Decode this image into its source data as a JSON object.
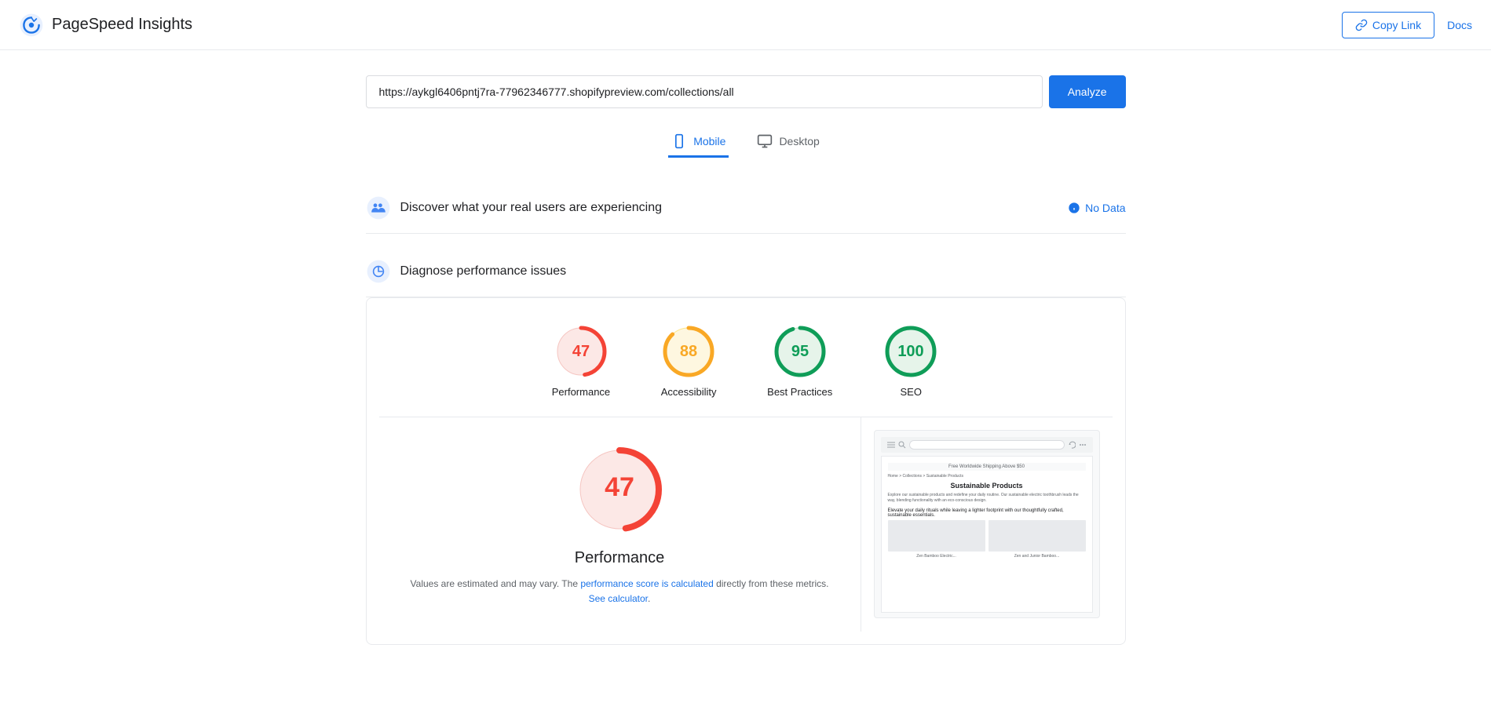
{
  "header": {
    "app_name": "PageSpeed Insights",
    "copy_link_label": "Copy Link",
    "docs_label": "Docs"
  },
  "url_bar": {
    "url_value": "https://aykgl6406pntj7ra-77962346777.shopifypreview.com/collections/all",
    "analyze_label": "Analyze"
  },
  "device_tabs": [
    {
      "id": "mobile",
      "label": "Mobile",
      "active": true
    },
    {
      "id": "desktop",
      "label": "Desktop",
      "active": false
    }
  ],
  "real_users_section": {
    "title": "Discover what your real users are experiencing",
    "no_data_label": "No Data"
  },
  "diagnose_section": {
    "title": "Diagnose performance issues"
  },
  "scores": [
    {
      "id": "performance",
      "value": 47,
      "label": "Performance",
      "color": "#f44336",
      "bg_color": "#fce8e6",
      "stroke_color": "#f44336",
      "percent": 47
    },
    {
      "id": "accessibility",
      "value": 88,
      "label": "Accessibility",
      "color": "#f9a825",
      "bg_color": "#fef7e0",
      "stroke_color": "#f9a825",
      "percent": 88
    },
    {
      "id": "best-practices",
      "value": 95,
      "label": "Best Practices",
      "color": "#0f9d58",
      "bg_color": "#e6f4ea",
      "stroke_color": "#0f9d58",
      "percent": 95
    },
    {
      "id": "seo",
      "value": 100,
      "label": "SEO",
      "color": "#0f9d58",
      "bg_color": "#e6f4ea",
      "stroke_color": "#0f9d58",
      "percent": 100
    }
  ],
  "detail": {
    "score": 47,
    "title": "Performance",
    "note_part1": "Values are estimated and may vary. The ",
    "note_link1": "performance score is calculated",
    "note_part2": " directly from these metrics. ",
    "note_link2": "See calculator",
    "note_end": "."
  },
  "preview": {
    "banner": "Free Worldwide Shipping Above $50",
    "breadcrumb": "Home > Collections > Sustainable Products",
    "heading": "Sustainable Products",
    "body1": "Explore our sustainable products and redefine your daily routine. Our sustainable electric toothbrush leads the way, blending functionality with an eco-conscious design.",
    "body2": "Elevate your daily rituals while leaving a lighter footprint with our thoughtfully crafted, sustainable essentials.",
    "product1_name": "Zen Bamboo Electric...",
    "product2_name": "Zen and Junior Bamboo..."
  },
  "colors": {
    "blue": "#1a73e8",
    "red": "#f44336",
    "orange": "#f9a825",
    "green": "#0f9d58",
    "light_red_bg": "#fce8e6",
    "light_orange_bg": "#fef7e0",
    "light_green_bg": "#e6f4ea"
  }
}
